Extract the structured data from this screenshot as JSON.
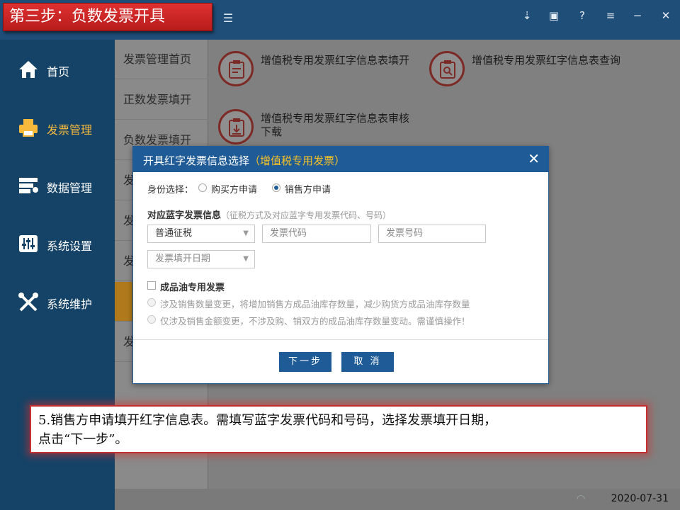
{
  "step_title": "第三步：负数发票开具",
  "sidebar": {
    "items": [
      {
        "label": "首页",
        "icon": "home-icon"
      },
      {
        "label": "发票管理",
        "icon": "printer-icon"
      },
      {
        "label": "数据管理",
        "icon": "database-icon"
      },
      {
        "label": "系统设置",
        "icon": "sliders-icon"
      },
      {
        "label": "系统维护",
        "icon": "tools-icon"
      }
    ]
  },
  "submenu": {
    "items": [
      "发票管理首页",
      "正数发票填开",
      "负数发票填开",
      "发",
      "发",
      "发",
      "",
      "发"
    ]
  },
  "content": {
    "cards": [
      {
        "label": "增值税专用发票红字信息表填开",
        "icon": "clipboard-edit-icon"
      },
      {
        "label": "增值税专用发票红字信息表查询",
        "icon": "clipboard-search-icon"
      },
      {
        "label": "增值税专用发票红字信息表审核下载",
        "icon": "clipboard-download-icon"
      }
    ]
  },
  "dialog": {
    "title": "开具红字发票信息选择",
    "title_sub": "（增值税专用发票）",
    "identity_label": "身份选择：",
    "identity_options": [
      "购买方申请",
      "销售方申请"
    ],
    "identity_selected": "销售方申请",
    "blue_invoice_label": "对应蓝字发票信息",
    "blue_invoice_hint": "（征税方式及对应蓝字专用发票代码、号码）",
    "tax_mode_value": "普通征税",
    "invoice_code_placeholder": "发票代码",
    "invoice_number_placeholder": "发票号码",
    "invoice_date_placeholder": "发票填开日期",
    "oil_checkbox_label": "成品油专用发票",
    "oil_options": [
      "涉及销售数量变更，将增加销售方成品油库存数量，减少购货方成品油库存数量",
      "仅涉及销售金额变更，不涉及购、销双方的成品油库存数量变动。需谨慎操作！"
    ],
    "next_label": "下一步",
    "cancel_label": "取 消"
  },
  "note": {
    "line1": "5.销售方申请填开红字信息表。需填写蓝字发票代码和号码，选择发票填开日期，",
    "line2": "点击“下一步”。"
  },
  "status": {
    "date": "2020-07-31"
  },
  "colors": {
    "topbar": "#1f4e79",
    "sidebar": "#154367",
    "accent": "#f6b93b",
    "dialog_header": "#1f5b96",
    "step_red": "#c62828"
  }
}
